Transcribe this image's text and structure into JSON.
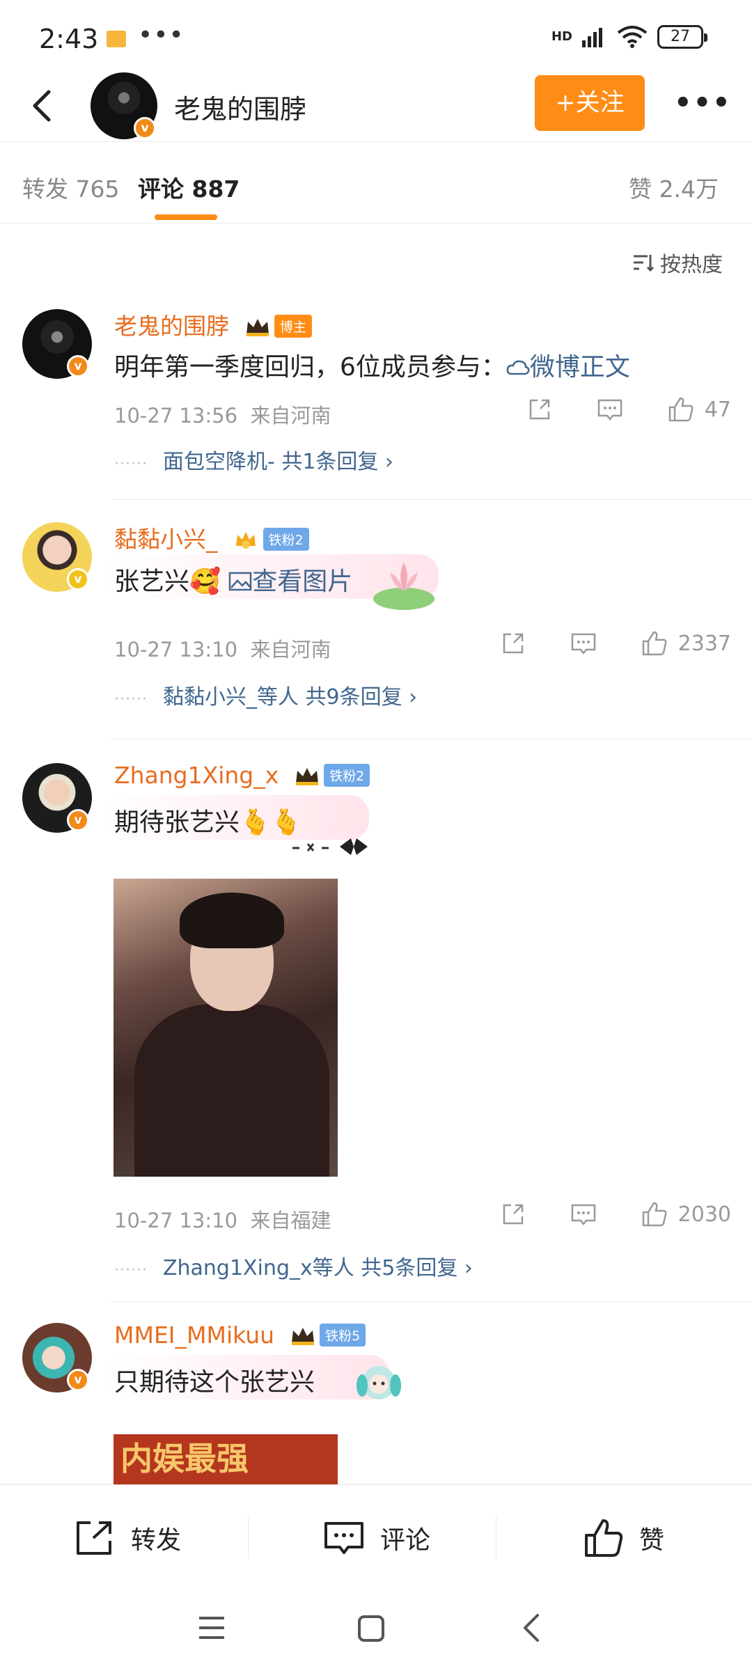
{
  "status_bar": {
    "time": "2:43",
    "dots": "•••",
    "network": "HD",
    "battery": "27"
  },
  "header": {
    "title": "老鬼的围脖",
    "follow_label": "+关注"
  },
  "tabs": [
    {
      "label": "转发",
      "count": "765"
    },
    {
      "label": "评论",
      "count": "887"
    }
  ],
  "likes_total": "赞 2.4万",
  "sort_label": "按热度",
  "comments": [
    {
      "name": "老鬼的围脖",
      "badge": "博主",
      "text": "明年第一季度回归，6位成员参与：",
      "link": "微博正文",
      "time": "10-27 13:56",
      "location": "来自河南",
      "likes": "47",
      "replies": "面包空降机- 共1条回复",
      "accent": "#e86c1f"
    },
    {
      "name": "黏黏小兴_",
      "badge": "铁粉2",
      "text": "张艺兴",
      "emoji": "🥰",
      "link": "查看图片",
      "time": "10-27 13:10",
      "location": "来自河南",
      "likes": "2337",
      "replies": "黏黏小兴_等人 共9条回复"
    },
    {
      "name": "Zhang1Xing_x",
      "badge": "铁粉2",
      "text": "期待张艺兴",
      "emoji": "🫰🫰",
      "time": "10-27 13:10",
      "location": "来自福建",
      "likes": "2030",
      "replies": "Zhang1Xing_x等人 共5条回复"
    },
    {
      "name": "MMEI_MMikuu",
      "badge": "铁粉5",
      "text": "只期待这个张艺兴",
      "banner_text": "内娱最强"
    }
  ],
  "bottom_bar": {
    "repost": "转发",
    "comment": "评论",
    "like": "赞"
  },
  "colors": {
    "accent": "#ff8c15",
    "link": "#41668f",
    "name": "#e86c1f"
  }
}
